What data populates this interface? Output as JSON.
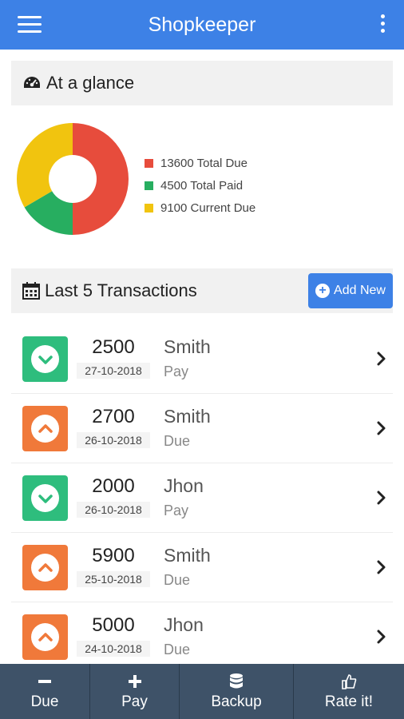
{
  "header": {
    "title": "Shopkeeper",
    "menu_icon": "hamburger-menu-icon",
    "more_icon": "more-vertical-icon",
    "color": "#3d81e6"
  },
  "glance": {
    "title": "At a glance",
    "icon": "dashboard-icon",
    "chart_data": {
      "type": "pie",
      "categories": [
        "Total Due",
        "Total Paid",
        "Current Due"
      ],
      "values": [
        13600,
        4500,
        9100
      ],
      "colors": [
        "#e74c3c",
        "#27ae60",
        "#f1c40f"
      ]
    },
    "legend": [
      {
        "label": "13600 Total Due",
        "color": "#e74c3c"
      },
      {
        "label": "4500 Total Paid",
        "color": "#27ae60"
      },
      {
        "label": "9100 Current Due",
        "color": "#f1c40f"
      }
    ]
  },
  "transactions_section": {
    "title": "Last 5 Transactions",
    "icon": "calendar-icon",
    "add_button": "Add New",
    "add_icon": "plus-circle-icon"
  },
  "transactions": [
    {
      "amount": "2500",
      "date": "27-10-2018",
      "name": "Smith",
      "type": "Pay",
      "icon": "arrow-down-circle-icon",
      "color": "#2ebd7d"
    },
    {
      "amount": "2700",
      "date": "26-10-2018",
      "name": "Smith",
      "type": "Due",
      "icon": "arrow-up-circle-icon",
      "color": "#f0793a"
    },
    {
      "amount": "2000",
      "date": "26-10-2018",
      "name": "Jhon",
      "type": "Pay",
      "icon": "arrow-down-circle-icon",
      "color": "#2ebd7d"
    },
    {
      "amount": "5900",
      "date": "25-10-2018",
      "name": "Smith",
      "type": "Due",
      "icon": "arrow-up-circle-icon",
      "color": "#f0793a"
    },
    {
      "amount": "5000",
      "date": "24-10-2018",
      "name": "Jhon",
      "type": "Due",
      "icon": "arrow-up-circle-icon",
      "color": "#f0793a"
    }
  ],
  "bottom_nav": [
    {
      "label": "Due",
      "icon": "minus-icon"
    },
    {
      "label": "Pay",
      "icon": "plus-icon"
    },
    {
      "label": "Backup",
      "icon": "database-icon"
    },
    {
      "label": "Rate it!",
      "icon": "thumbs-up-icon"
    }
  ]
}
